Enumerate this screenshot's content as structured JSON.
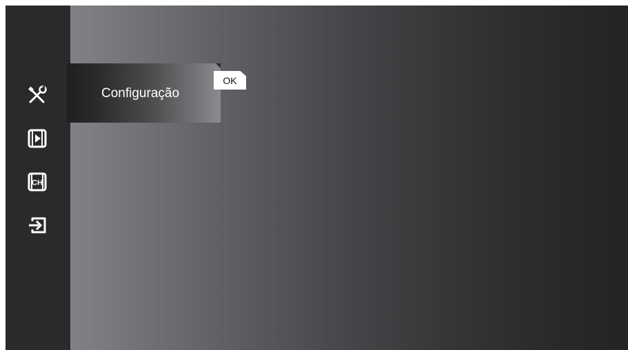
{
  "sidebar": {
    "items": [
      {
        "icon": "tools-icon",
        "label": ""
      },
      {
        "icon": "media-play-icon",
        "label": ""
      },
      {
        "icon": "channel-icon",
        "label": "CH"
      },
      {
        "icon": "input-source-icon",
        "label": ""
      }
    ]
  },
  "menu": {
    "selected_label": "Configuração",
    "ok_label": "OK"
  },
  "colors": {
    "sidebar_bg": "#2a292b",
    "gradient_left": "#8d8e93",
    "gradient_right": "#252326",
    "text": "#ffffff"
  }
}
